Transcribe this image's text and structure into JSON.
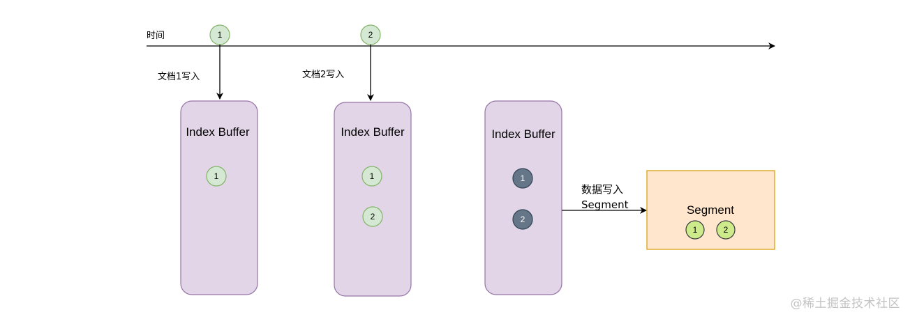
{
  "timeline": {
    "label": "时间",
    "markers": [
      "1",
      "2"
    ]
  },
  "writes": [
    {
      "label": "文档1写入"
    },
    {
      "label": "文档2写入"
    }
  ],
  "buffers": [
    {
      "title": "Index Buffer",
      "docs": [
        "1"
      ],
      "state": "pending"
    },
    {
      "title": "Index Buffer",
      "docs": [
        "1",
        "2"
      ],
      "state": "pending"
    },
    {
      "title": "Index Buffer",
      "docs": [
        "1",
        "2"
      ],
      "state": "flushed"
    }
  ],
  "flush_arrow": {
    "line1": "数据写入",
    "line2": "Segment"
  },
  "segment": {
    "title": "Segment",
    "docs": [
      "1",
      "2"
    ]
  },
  "watermark": "@稀土掘金技术社区",
  "colors": {
    "buffer_fill": "#e1d5e7",
    "buffer_stroke": "#9673a6",
    "segment_fill": "#ffe6cc",
    "segment_stroke": "#d79b00",
    "doc_fill": "#d5e8d4",
    "doc_stroke": "#82b366",
    "doc_strong_fill": "#cdeb8b",
    "doc_strong_stroke": "#36393d",
    "flushed_fill": "#647687",
    "flushed_stroke": "#314354",
    "line": "#000000"
  }
}
